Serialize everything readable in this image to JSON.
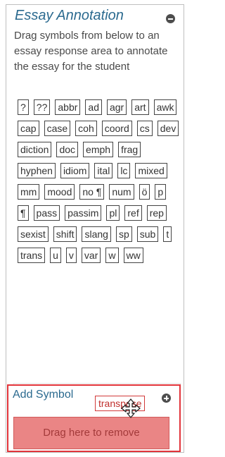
{
  "panel": {
    "title": "Essay Annotation",
    "instructions": "Drag symbols from below to an essay response area to annotate the essay for the student",
    "symbols": [
      "?",
      "??",
      "abbr",
      "ad",
      "agr",
      "art",
      "awk",
      "cap",
      "case",
      "coh",
      "coord",
      "cs",
      "dev",
      "diction",
      "doc",
      "emph",
      "frag",
      "hyphen",
      "idiom",
      "ital",
      "lc",
      "mixed",
      "mm",
      "mood",
      "no ¶",
      "num",
      "ö",
      "p",
      "¶",
      "pass",
      "passim",
      "pl",
      "ref",
      "rep",
      "sexist",
      "shift",
      "slang",
      "sp",
      "sub",
      "t",
      "trans",
      "u",
      "v",
      "var",
      "w",
      "ww"
    ]
  },
  "add_symbol": {
    "title": "Add Symbol"
  },
  "remove_zone": {
    "label": "Drag here to remove"
  },
  "drag_ghost": {
    "label": "transpose"
  },
  "colors": {
    "title_blue": "#2b6a8f",
    "remove_fill": "#ea8585",
    "remove_border": "#e2343a",
    "ghost_red": "#c0302d"
  },
  "icons": {
    "collapse": "minus-circle-icon",
    "add": "plus-circle-icon",
    "cursor": "move-cursor-icon"
  }
}
